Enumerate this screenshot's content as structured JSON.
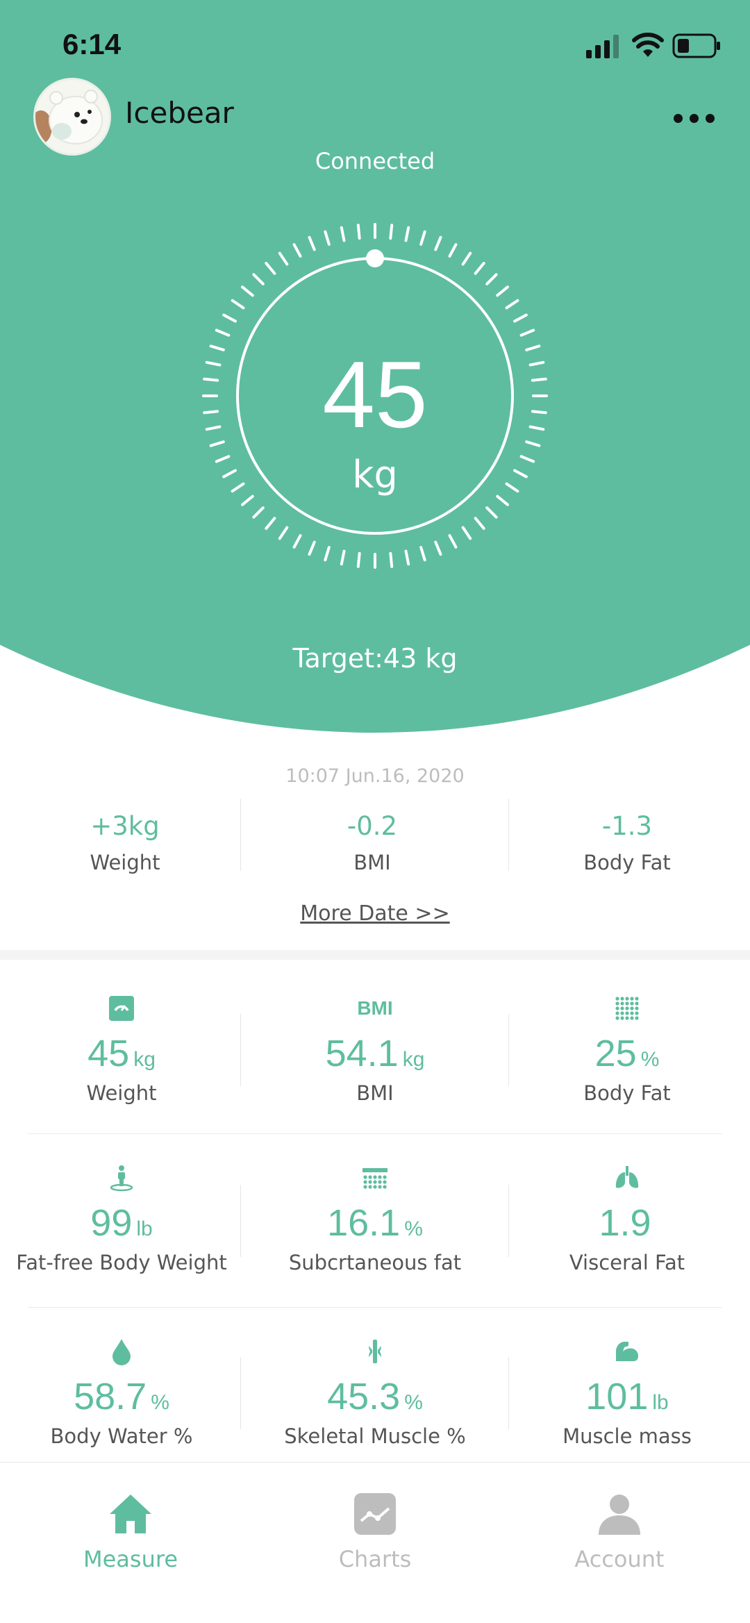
{
  "status_bar": {
    "time": "6:14"
  },
  "header": {
    "username": "Icebear",
    "connection_status": "Connected",
    "more_icon": "more-icon",
    "avatar_icon": "avatar"
  },
  "gauge": {
    "value": "45",
    "unit": "kg",
    "target": "Target:43 kg"
  },
  "changes": {
    "timestamp": "10:07  Jun.16, 2020",
    "items": [
      {
        "value": "+3kg",
        "label": "Weight"
      },
      {
        "value": "-0.2",
        "label": "BMI"
      },
      {
        "value": "-1.3",
        "label": "Body Fat"
      }
    ],
    "more_link": "More Date >>"
  },
  "metrics": [
    {
      "icon": "scale-icon",
      "icon_text": "",
      "value": "45",
      "unit": "kg",
      "label": "Weight"
    },
    {
      "icon": "bmi-icon",
      "icon_text": "BMI",
      "value": "54.1",
      "unit": "kg",
      "label": "BMI"
    },
    {
      "icon": "body-fat-icon",
      "icon_text": "",
      "value": "25",
      "unit": "%",
      "label": "Body Fat"
    },
    {
      "icon": "body-weight-icon",
      "icon_text": "",
      "value": "99",
      "unit": "lb",
      "label": "Fat-free Body Weight"
    },
    {
      "icon": "subcutaneous-fat-icon",
      "icon_text": "",
      "value": "16.1",
      "unit": "%",
      "label": "Subcrtaneous fat"
    },
    {
      "icon": "lungs-icon",
      "icon_text": "",
      "value": "1.9",
      "unit": "",
      "label": "Visceral Fat"
    },
    {
      "icon": "water-drop-icon",
      "icon_text": "",
      "value": "58.7",
      "unit": "%",
      "label": "Body Water %"
    },
    {
      "icon": "skeleton-icon",
      "icon_text": "",
      "value": "45.3",
      "unit": "%",
      "label": "Skeletal Muscle %"
    },
    {
      "icon": "muscle-icon",
      "icon_text": "",
      "value": "101",
      "unit": "lb",
      "label": "Muscle mass"
    }
  ],
  "tabs": [
    {
      "label": "Measure",
      "icon": "home-icon",
      "active": true
    },
    {
      "label": "Charts",
      "icon": "chart-icon",
      "active": false
    },
    {
      "label": "Account",
      "icon": "person-icon",
      "active": false
    }
  ],
  "colors": {
    "accent": "#5ebd9f",
    "inactive": "#bdbdbd",
    "text": "#555555"
  }
}
